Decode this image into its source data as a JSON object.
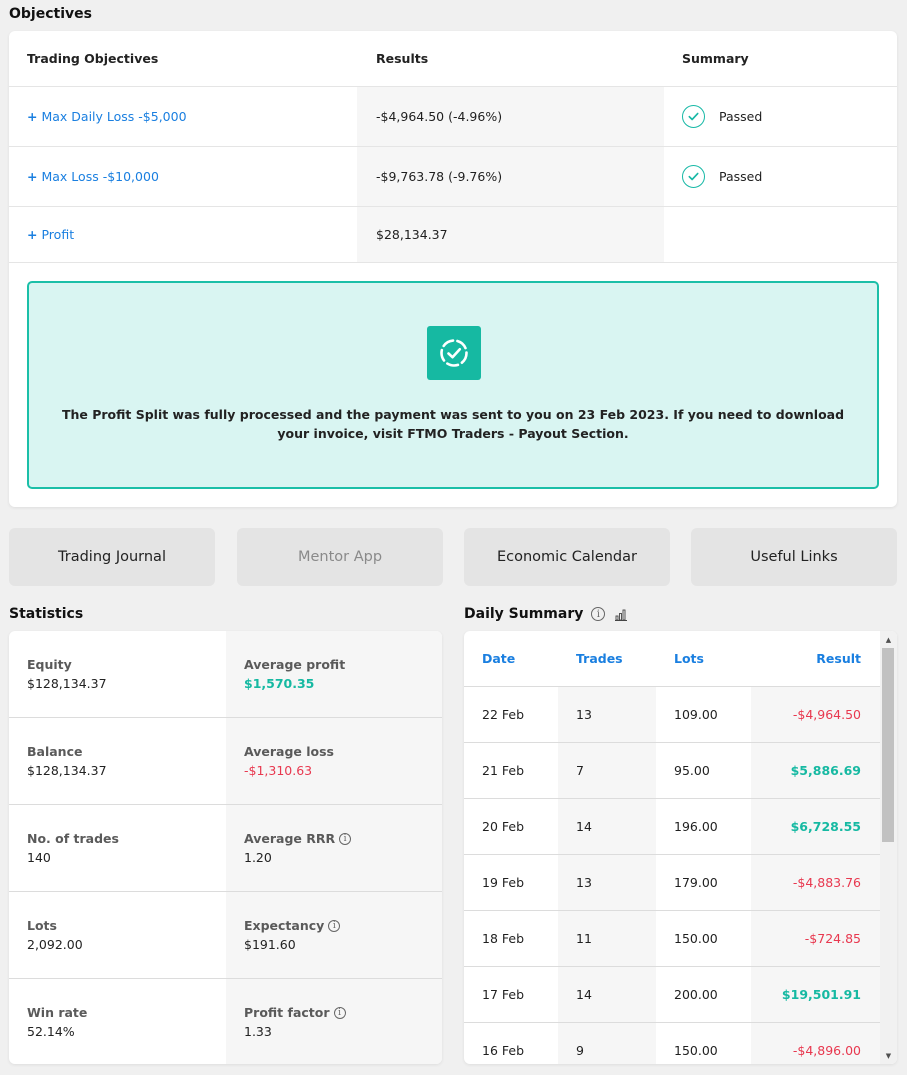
{
  "objectives": {
    "title": "Objectives",
    "headers": {
      "objective": "Trading Objectives",
      "results": "Results",
      "summary": "Summary"
    },
    "rows": [
      {
        "objective": "Max Daily Loss -$5,000",
        "result": "-$4,964.50 (-4.96%)",
        "summary": "Passed"
      },
      {
        "objective": "Max Loss -$10,000",
        "result": "-$9,763.78 (-9.76%)",
        "summary": "Passed"
      },
      {
        "objective": "Profit",
        "result": "$28,134.37",
        "summary": ""
      }
    ],
    "plus": "+",
    "notice": "The Profit Split was fully processed and the payment was sent to you on 23 Feb 2023. If you need to download your invoice, visit FTMO Traders - Payout Section."
  },
  "tools": {
    "journal": "Trading Journal",
    "mentor": "Mentor App",
    "calendar": "Economic Calendar",
    "links": "Useful Links"
  },
  "statistics": {
    "title": "Statistics",
    "rows": [
      {
        "left_label": "Equity",
        "left_value": "$128,134.37",
        "right_label": "Average profit",
        "right_value": "$1,570.35"
      },
      {
        "left_label": "Balance",
        "left_value": "$128,134.37",
        "right_label": "Average loss",
        "right_value": "-$1,310.63"
      },
      {
        "left_label": "No. of trades",
        "left_value": "140",
        "right_label": "Average RRR",
        "right_value": "1.20"
      },
      {
        "left_label": "Lots",
        "left_value": "2,092.00",
        "right_label": "Expectancy",
        "right_value": "$191.60"
      },
      {
        "left_label": "Win rate",
        "left_value": "52.14%",
        "right_label": "Profit factor",
        "right_value": "1.33"
      }
    ]
  },
  "daily": {
    "title": "Daily Summary",
    "headers": {
      "date": "Date",
      "trades": "Trades",
      "lots": "Lots",
      "result": "Result"
    },
    "rows": [
      {
        "date": "22 Feb",
        "trades": "13",
        "lots": "109.00",
        "result": "-$4,964.50"
      },
      {
        "date": "21 Feb",
        "trades": "7",
        "lots": "95.00",
        "result": "$5,886.69"
      },
      {
        "date": "20 Feb",
        "trades": "14",
        "lots": "196.00",
        "result": "$6,728.55"
      },
      {
        "date": "19 Feb",
        "trades": "13",
        "lots": "179.00",
        "result": "-$4,883.76"
      },
      {
        "date": "18 Feb",
        "trades": "11",
        "lots": "150.00",
        "result": "-$724.85"
      },
      {
        "date": "17 Feb",
        "trades": "14",
        "lots": "200.00",
        "result": "$19,501.91"
      },
      {
        "date": "16 Feb",
        "trades": "9",
        "lots": "150.00",
        "result": "-$4,896.00"
      }
    ]
  },
  "colors": {
    "accent": "#16b9a2",
    "link": "#1a7fe0",
    "negative": "#e8384f",
    "notice_bg": "#d9f5f2"
  },
  "icons": {
    "passed": "check-circle-icon",
    "notice": "dashed-check-icon",
    "info": "info-icon",
    "chart": "bar-chart-icon"
  }
}
